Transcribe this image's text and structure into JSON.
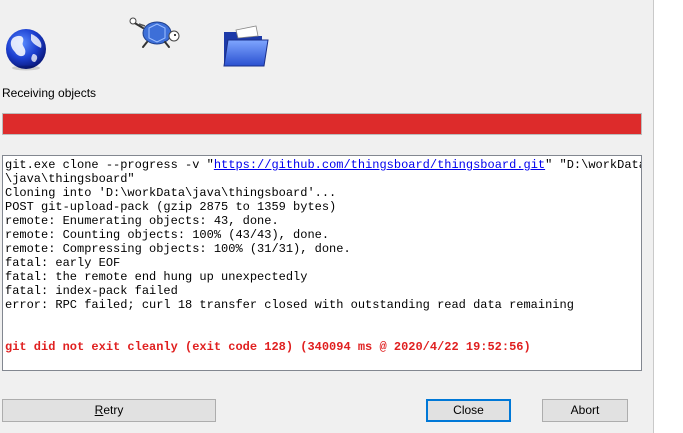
{
  "status": {
    "label": "Receiving objects",
    "progress_fraction": 1.0,
    "progress_color": "#dd2b2b"
  },
  "icons": {
    "globe": "globe-icon",
    "turtle": "tortoise-icon",
    "folder": "folder-icon"
  },
  "log": {
    "command_prefix": "git.exe clone --progress -v \"",
    "url": "https://github.com/thingsboard/thingsboard.git",
    "command_suffix": "\" \"D:\\workData",
    "lines": [
      "\\java\\thingsboard\"",
      "Cloning into 'D:\\workData\\java\\thingsboard'...",
      "POST git-upload-pack (gzip 2875 to 1359 bytes)",
      "remote: Enumerating objects: 43, done.",
      "remote: Counting objects: 100% (43/43), done.",
      "remote: Compressing objects: 100% (31/31), done.",
      "fatal: early EOF",
      "fatal: the remote end hung up unexpectedly",
      "fatal: index-pack failed",
      "error: RPC failed; curl 18 transfer closed with outstanding read data remaining"
    ],
    "error_message": "git did not exit cleanly (exit code 128) (340094 ms @ 2020/4/22 19:52:56)",
    "error_color": "#e02020"
  },
  "buttons": {
    "retry_accel": "R",
    "retry_rest": "etry",
    "close": "Close",
    "abort": "Abort"
  }
}
